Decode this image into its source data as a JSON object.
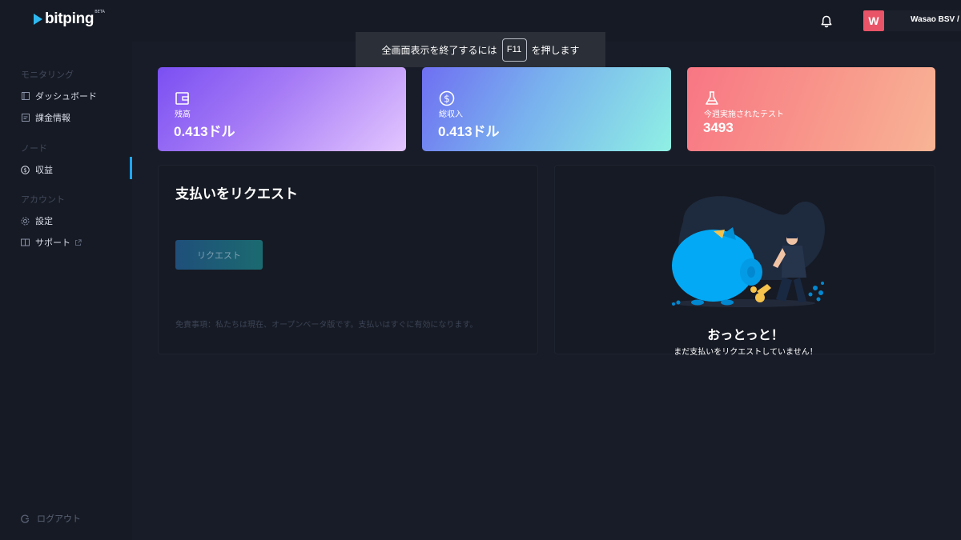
{
  "brand": {
    "name": "bitping",
    "badge": "BETA"
  },
  "header": {
    "avatar_letter": "W",
    "user_name": "Wasao BSV / C"
  },
  "toast": {
    "before": "全画面表示を終了するには",
    "key": "F11",
    "after": "を押します"
  },
  "sidebar": {
    "sections": [
      {
        "title": "モニタリング",
        "items": [
          {
            "label": "ダッシュボード",
            "icon": "dashboard-icon"
          },
          {
            "label": "課金情報",
            "icon": "billing-icon"
          }
        ]
      },
      {
        "title": "ノード",
        "items": [
          {
            "label": "収益",
            "icon": "dollar-icon",
            "active": true
          }
        ]
      },
      {
        "title": "アカウント",
        "items": [
          {
            "label": "設定",
            "icon": "gear-icon"
          },
          {
            "label": "サポート",
            "icon": "support-icon",
            "external": true
          }
        ]
      }
    ],
    "logout": "ログアウト"
  },
  "stats": [
    {
      "label": "残高",
      "value": "0.413ドル",
      "icon": "wallet-icon"
    },
    {
      "label": "総収入",
      "value": "0.413ドル",
      "icon": "dollar-icon"
    },
    {
      "label": "今週実施されたテスト",
      "value": "3493",
      "icon": "flask-icon"
    }
  ],
  "payout": {
    "title": "支払いをリクエスト",
    "button": "リクエスト",
    "disclaimer": "免責事項：私たちは現在、オープンベータ版です。支払いはすぐに有効になります。"
  },
  "empty_state": {
    "title": "おっとっと！",
    "subtitle": "まだ支払いをリクエストしていません！"
  },
  "colors": {
    "accent": "#1fa6f0",
    "background": "#161a24",
    "avatar": "#ea5468"
  }
}
